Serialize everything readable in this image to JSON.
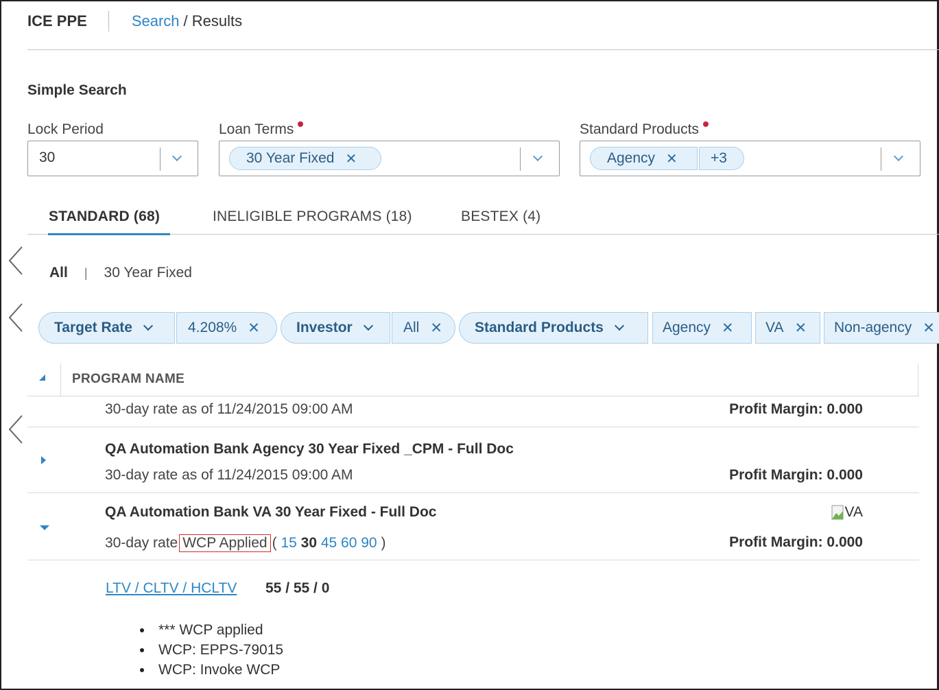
{
  "header": {
    "app_title": "ICE PPE",
    "breadcrumb_link": "Search",
    "breadcrumb_rest": "/ Results"
  },
  "simple_search": {
    "title": "Simple Search",
    "lock_period": {
      "label": "Lock Period",
      "value": "30"
    },
    "loan_terms": {
      "label": "Loan Terms",
      "chips": [
        "30 Year Fixed"
      ]
    },
    "standard_products": {
      "label": "Standard Products",
      "chips": [
        "Agency"
      ],
      "more": "+3"
    }
  },
  "tabs": [
    {
      "label": "STANDARD (68)",
      "active": true
    },
    {
      "label": "INELIGIBLE PROGRAMS (18)",
      "active": false
    },
    {
      "label": "BESTEX (4)",
      "active": false
    }
  ],
  "subfilter": {
    "all": "All",
    "term": "30 Year Fixed"
  },
  "filters": {
    "target_rate_label": "Target Rate",
    "target_rate_value": "4.208%",
    "investor_label": "Investor",
    "investor_value": "All",
    "standard_products_label": "Standard Products",
    "standard_products_values": [
      "Agency",
      "VA",
      "Non-agency"
    ]
  },
  "table": {
    "column_header": "PROGRAM NAME",
    "rows": [
      {
        "title": "",
        "subtitle": "30-day rate as of 11/24/2015 09:00 AM",
        "profit": "Profit Margin: 0.000"
      },
      {
        "title": "QA Automation Bank Agency 30 Year Fixed _CPM - Full Doc",
        "subtitle": "30-day rate as of 11/24/2015 09:00 AM",
        "profit": "Profit Margin: 0.000"
      },
      {
        "title": "QA Automation Bank VA 30 Year Fixed - Full Doc",
        "subtitle_prefix": "30-day rate",
        "wcp_badge": "WCP Applied",
        "paren_open": "(",
        "lock_options": [
          "15",
          "30",
          "45",
          "60",
          "90"
        ],
        "paren_close": ")",
        "image_alt": "VA",
        "profit": "Profit Margin: 0.000"
      }
    ]
  },
  "detail": {
    "ltv_link": "LTV / CLTV / HCLTV",
    "ltv_value": "55 / 55 / 0",
    "notes": [
      "*** WCP applied",
      "WCP: EPPS-79015",
      "WCP: Invoke WCP"
    ]
  },
  "colors": {
    "accent": "#2d86c4",
    "chip_bg": "#e4f1fb",
    "required": "#c8243b",
    "highlight_box": "#d22a2a"
  }
}
